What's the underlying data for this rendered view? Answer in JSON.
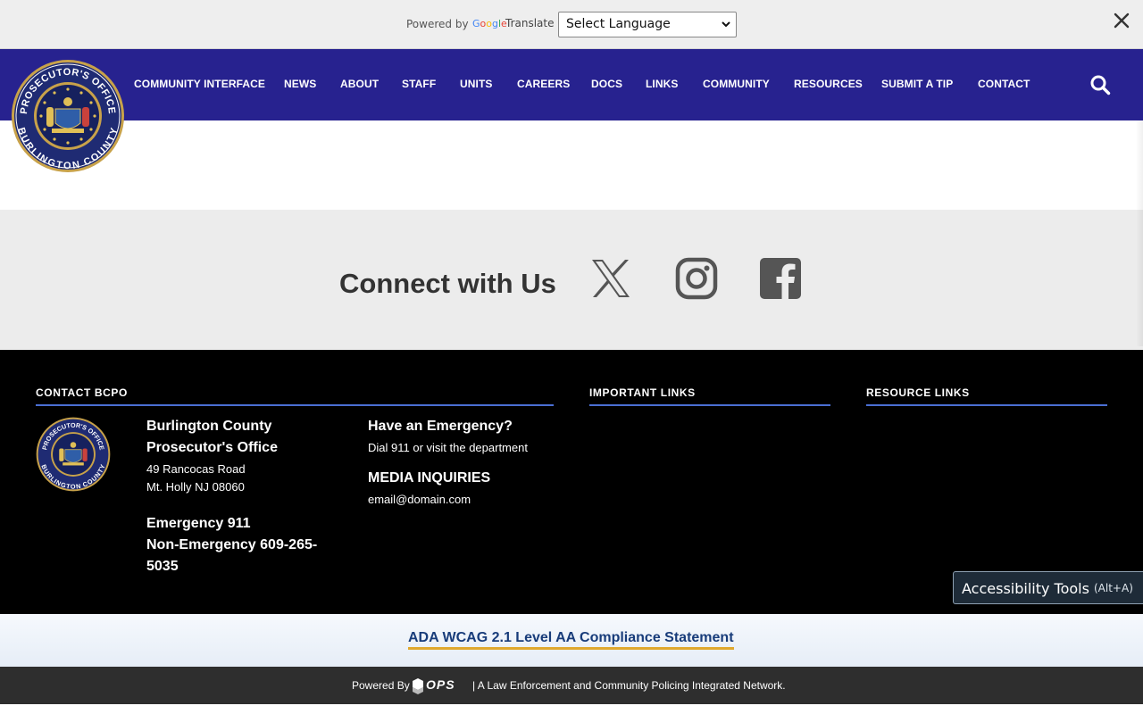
{
  "translate_bar": {
    "powered_by": "Powered by",
    "google": "Google",
    "translate": "Translate",
    "language_selected": "Select Language"
  },
  "nav": {
    "items": [
      {
        "label": "COMMUNITY INTERFACE"
      },
      {
        "label": "NEWS"
      },
      {
        "label": "ABOUT"
      },
      {
        "label": "STAFF"
      },
      {
        "label": "UNITS"
      },
      {
        "label": "CAREERS"
      },
      {
        "label": "DOCS"
      },
      {
        "label": "LINKS"
      },
      {
        "label": "COMMUNITY"
      },
      {
        "label": "RESOURCES"
      },
      {
        "label": "SUBMIT A TIP"
      },
      {
        "label": "CONTACT"
      }
    ]
  },
  "logo": {
    "top_text": "PROSECUTOR'S OFFICE",
    "bottom_text": "BURLINGTON COUNTY"
  },
  "connect": {
    "title": "Connect with Us",
    "social": [
      "x-icon",
      "instagram-icon",
      "facebook-icon"
    ]
  },
  "footer": {
    "contact_heading": "CONTACT BCPO",
    "important_heading": "IMPORTANT LINKS",
    "resource_heading": "RESOURCE LINKS",
    "office_name_line1": "Burlington County",
    "office_name_line2": "Prosecutor's Office",
    "address_line1": "49 Rancocas Road",
    "address_line2": "Mt. Holly NJ 08060",
    "emergency_line": "Emergency 911",
    "non_emergency_line1": "Non-Emergency 609-265-",
    "non_emergency_line2": "5035",
    "have_emergency": "Have an Emergency?",
    "have_emergency_sub": "Dial 911 or visit the department",
    "media_heading": "MEDIA INQUIRIES",
    "media_email": "email@domain.com"
  },
  "accessibility": {
    "label": "Accessibility Tools",
    "shortcut": "(Alt+A)"
  },
  "ada": {
    "link": "ADA WCAG 2.1 Level AA Compliance Statement"
  },
  "bottom": {
    "powered_by": "Powered By",
    "logo_text": "OPS",
    "tagline": "| A Law Enforcement and Community Policing Integrated Network."
  },
  "colors": {
    "nav_bg": "#27228f",
    "footer_bg": "#000000",
    "accent_line": "#4a6fd3",
    "ada_underline": "#e0a82e"
  }
}
